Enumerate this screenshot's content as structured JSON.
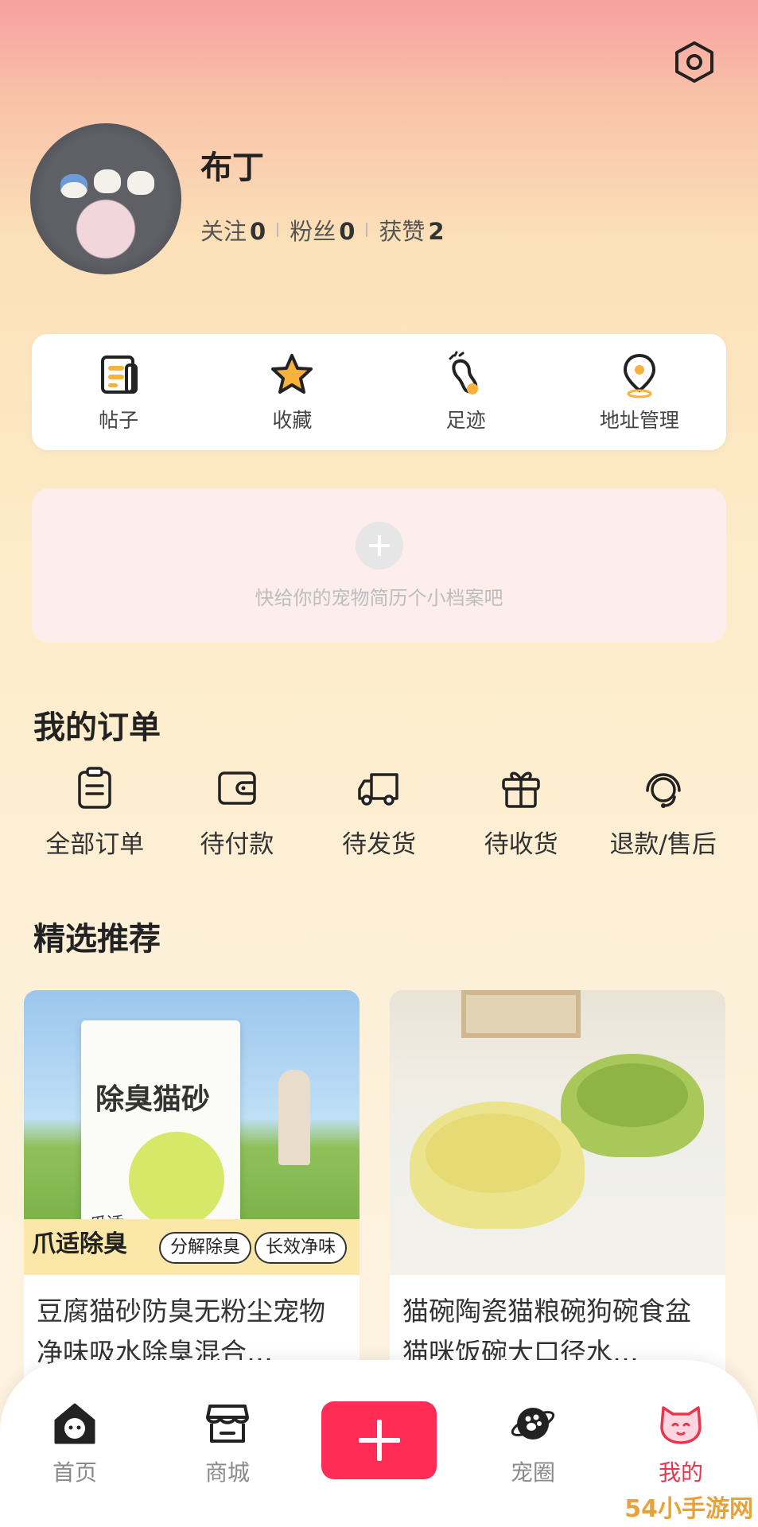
{
  "profile": {
    "nickname": "布丁",
    "following_label": "关注",
    "following_count": "0",
    "followers_label": "粉丝",
    "followers_count": "0",
    "likes_label": "获赞",
    "likes_count": "2"
  },
  "quick_menu": [
    {
      "label": "帖子",
      "icon": "posts-icon"
    },
    {
      "label": "收藏",
      "icon": "star-icon"
    },
    {
      "label": "足迹",
      "icon": "footprint-icon"
    },
    {
      "label": "地址管理",
      "icon": "location-pin-icon"
    }
  ],
  "pet_card": {
    "hint": "快给你的宠物简历个小档案吧"
  },
  "orders": {
    "title": "我的订单",
    "items": [
      {
        "label": "全部订单",
        "icon": "clipboard-icon"
      },
      {
        "label": "待付款",
        "icon": "wallet-icon"
      },
      {
        "label": "待发货",
        "icon": "truck-icon"
      },
      {
        "label": "待收货",
        "icon": "gift-icon"
      },
      {
        "label": "退款/售后",
        "icon": "headset-icon"
      }
    ]
  },
  "recommend": {
    "title": "精选推荐",
    "products": [
      {
        "title": "豆腐猫砂防臭无粉尘宠物净味吸水除臭混合…",
        "image_text": {
          "bag_title": "除臭猫砂",
          "bag_brand": "爪适 cozypaw",
          "banner_title": "爪适除臭",
          "tag1": "分解除臭",
          "tag2": "长效净味"
        }
      },
      {
        "title": "猫碗陶瓷猫粮碗狗碗食盆猫咪饭碗大口径水…"
      }
    ]
  },
  "nav": {
    "home": "首页",
    "mall": "商城",
    "circle": "宠圈",
    "mine": "我的",
    "active_color": "#e8364f",
    "add_color": "#ff2d55"
  },
  "watermark": "54小手游网"
}
